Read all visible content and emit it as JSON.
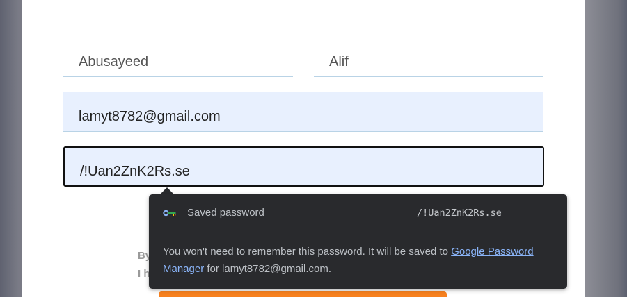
{
  "form": {
    "first_name": "Abusayeed",
    "last_name": "Alif",
    "email": "lamyt8782@gmail.com",
    "password": "/!Uan2ZnK2Rs.se",
    "terms_line1": "By",
    "terms_line2": "I h"
  },
  "password_popup": {
    "saved_label": "Saved password",
    "saved_value": "/!Uan2ZnK2Rs.se",
    "message_prefix": "You won't need to remember this password. It will be saved to ",
    "link_text": "Google Password Manager",
    "message_suffix": " for lamyt8782@gmail.com.",
    "icon": "key-icon"
  },
  "colors": {
    "autofill_bg": "#e8f0fe",
    "popup_bg": "#292a2d",
    "link": "#8ab4f8",
    "submit": "#f7811f"
  }
}
